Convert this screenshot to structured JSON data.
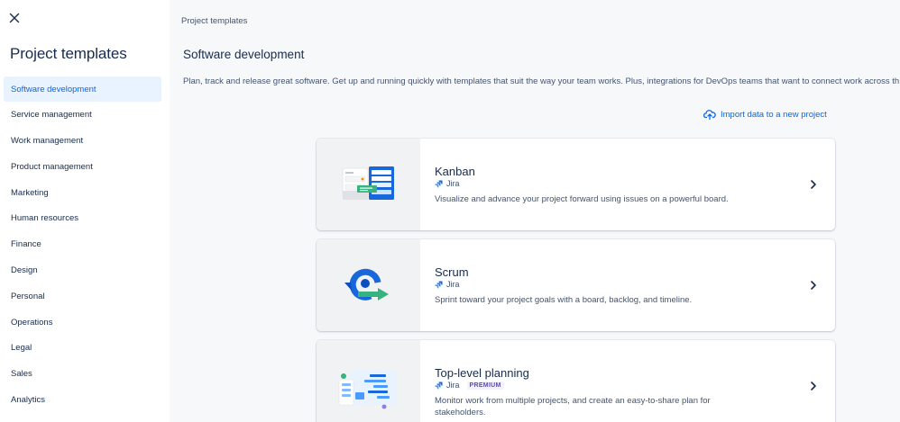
{
  "sidebar": {
    "title": "Project templates",
    "items": [
      {
        "label": "Software development",
        "active": true
      },
      {
        "label": "Service management"
      },
      {
        "label": "Work management"
      },
      {
        "label": "Product management"
      },
      {
        "label": "Marketing"
      },
      {
        "label": "Human resources"
      },
      {
        "label": "Finance"
      },
      {
        "label": "Design"
      },
      {
        "label": "Personal"
      },
      {
        "label": "Operations"
      },
      {
        "label": "Legal"
      },
      {
        "label": "Sales"
      },
      {
        "label": "Analytics"
      }
    ]
  },
  "main": {
    "breadcrumb": "Project templates",
    "title": "Software development",
    "description": "Plan, track and release great software. Get up and running quickly with templates that suit the way your team works. Plus, integrations for DevOps teams that want to connect work across th",
    "import_label": "Import data to a new project",
    "cards": [
      {
        "title": "Kanban",
        "product": "Jira",
        "description": "Visualize and advance your project forward using issues on a powerful board."
      },
      {
        "title": "Scrum",
        "product": "Jira",
        "description": "Sprint toward your project goals with a board, backlog, and timeline."
      },
      {
        "title": "Top-level planning",
        "product": "Jira",
        "badge": "PREMIUM",
        "description": "Monitor work from multiple projects, and create an easy-to-share plan for stakeholders."
      }
    ]
  },
  "icons": {
    "close": "close-icon",
    "cloud_upload": "cloud-upload-icon",
    "jira": "jira-icon",
    "chevron": "chevron-right-icon"
  },
  "colors": {
    "accent": "#0c66e4",
    "active_bg": "#e9f2ff",
    "text": "#172b4d",
    "subtle_text": "#44546f"
  }
}
